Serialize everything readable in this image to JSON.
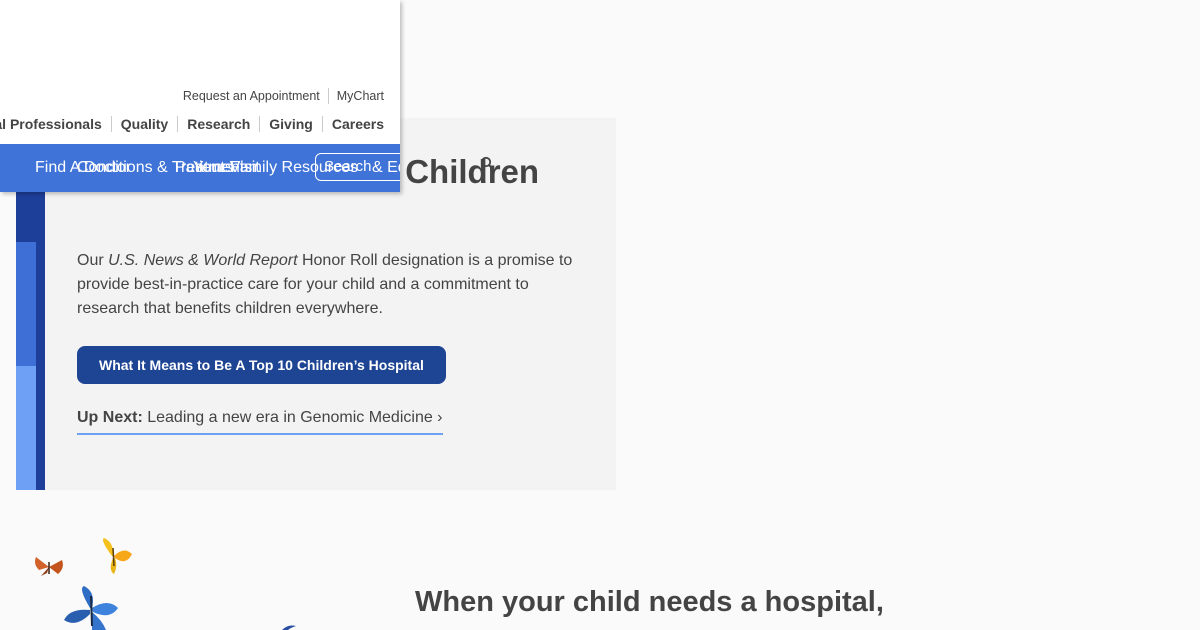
{
  "header": {
    "utility_nav": [
      "Request an Appointment",
      "MyChart"
    ],
    "main_nav": [
      "For Medical Professionals",
      "Quality",
      "Research",
      "Giving",
      "Careers"
    ],
    "blue_bar": {
      "find": "Find A Doctor",
      "conditions": "Conditions & Treatments",
      "patients": "Patients",
      "visit": "Your Visit",
      "family": "Family Resources",
      "education": "& Education",
      "search_placeholder": "Search"
    }
  },
  "hero": {
    "title": "Better Outcomes for Children",
    "body_prefix": "Our ",
    "body_italic": "U.S. News & World Report",
    "body_suffix": " Honor Roll designation is a promise to provide best-in-practice care for your child and a commitment to research that benefits children everywhere.",
    "cta_label": "What It Means to Be A Top 10 Children’s Hospital",
    "up_next_label": "Up Next:",
    "up_next_text": "Leading a new era in Genomic Medicine ›"
  },
  "section": {
    "title": "When your child needs a hospital,"
  },
  "colors": {
    "brand_dark": "#1e3f99",
    "brand_mid": "#3d6fd6",
    "brand_light": "#6ea1f5",
    "nav_bar": "#3f73d8",
    "cta": "#1e4494"
  }
}
